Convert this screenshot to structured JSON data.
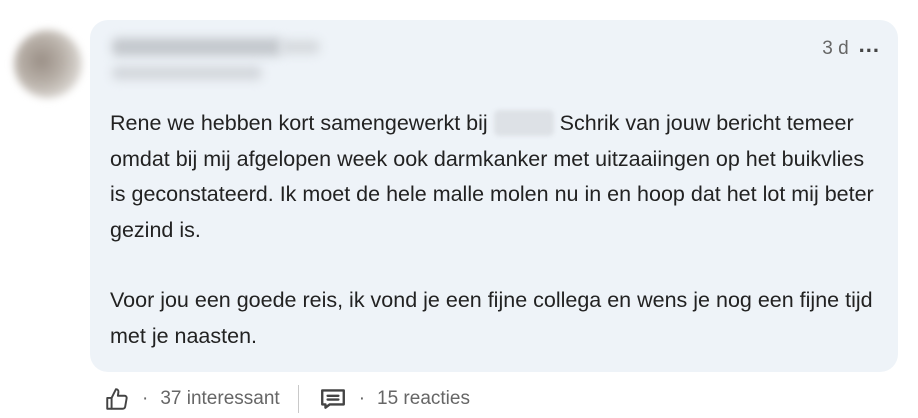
{
  "comment": {
    "timestamp": "3 d",
    "more_icon": "...",
    "paragraph1_part1": "Rene  we hebben kort samengewerkt bij",
    "paragraph1_part2": "Schrik van jouw bericht temeer omdat bij mij afgelopen week ook darmkanker met uitzaaiingen op het buikvlies is geconstateerd. Ik moet de hele malle molen nu in en hoop dat het lot mij beter gezind is.",
    "paragraph2": "Voor jou een goede reis, ik vond je een fijne collega en wens je nog een fijne tijd met je naasten."
  },
  "reactions": {
    "icon": "thumbs-up-icon",
    "separator": "·",
    "count_label": "37 interessant"
  },
  "replies": {
    "icon": "comment-icon",
    "separator": "·",
    "count_label": "15 reacties"
  }
}
